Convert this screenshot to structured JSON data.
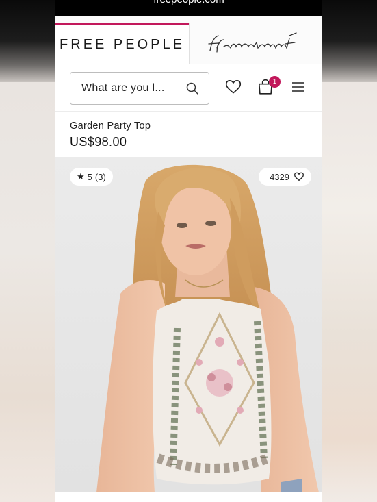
{
  "browser": {
    "url": "freepeople.com"
  },
  "brand": {
    "logo_text": "FREE PEOPLE",
    "movement_text": "fp movement",
    "accent_color": "#c2185b"
  },
  "header": {
    "search_placeholder": "What are you l...",
    "icons": [
      "search-icon",
      "heart-icon",
      "shopping-bag-icon",
      "hamburger-menu-icon"
    ],
    "bag_count": "1"
  },
  "product": {
    "name": "Garden Party Top",
    "price": "US$98.00",
    "rating_value": "5",
    "rating_count": "(3)",
    "likes": "4329"
  }
}
